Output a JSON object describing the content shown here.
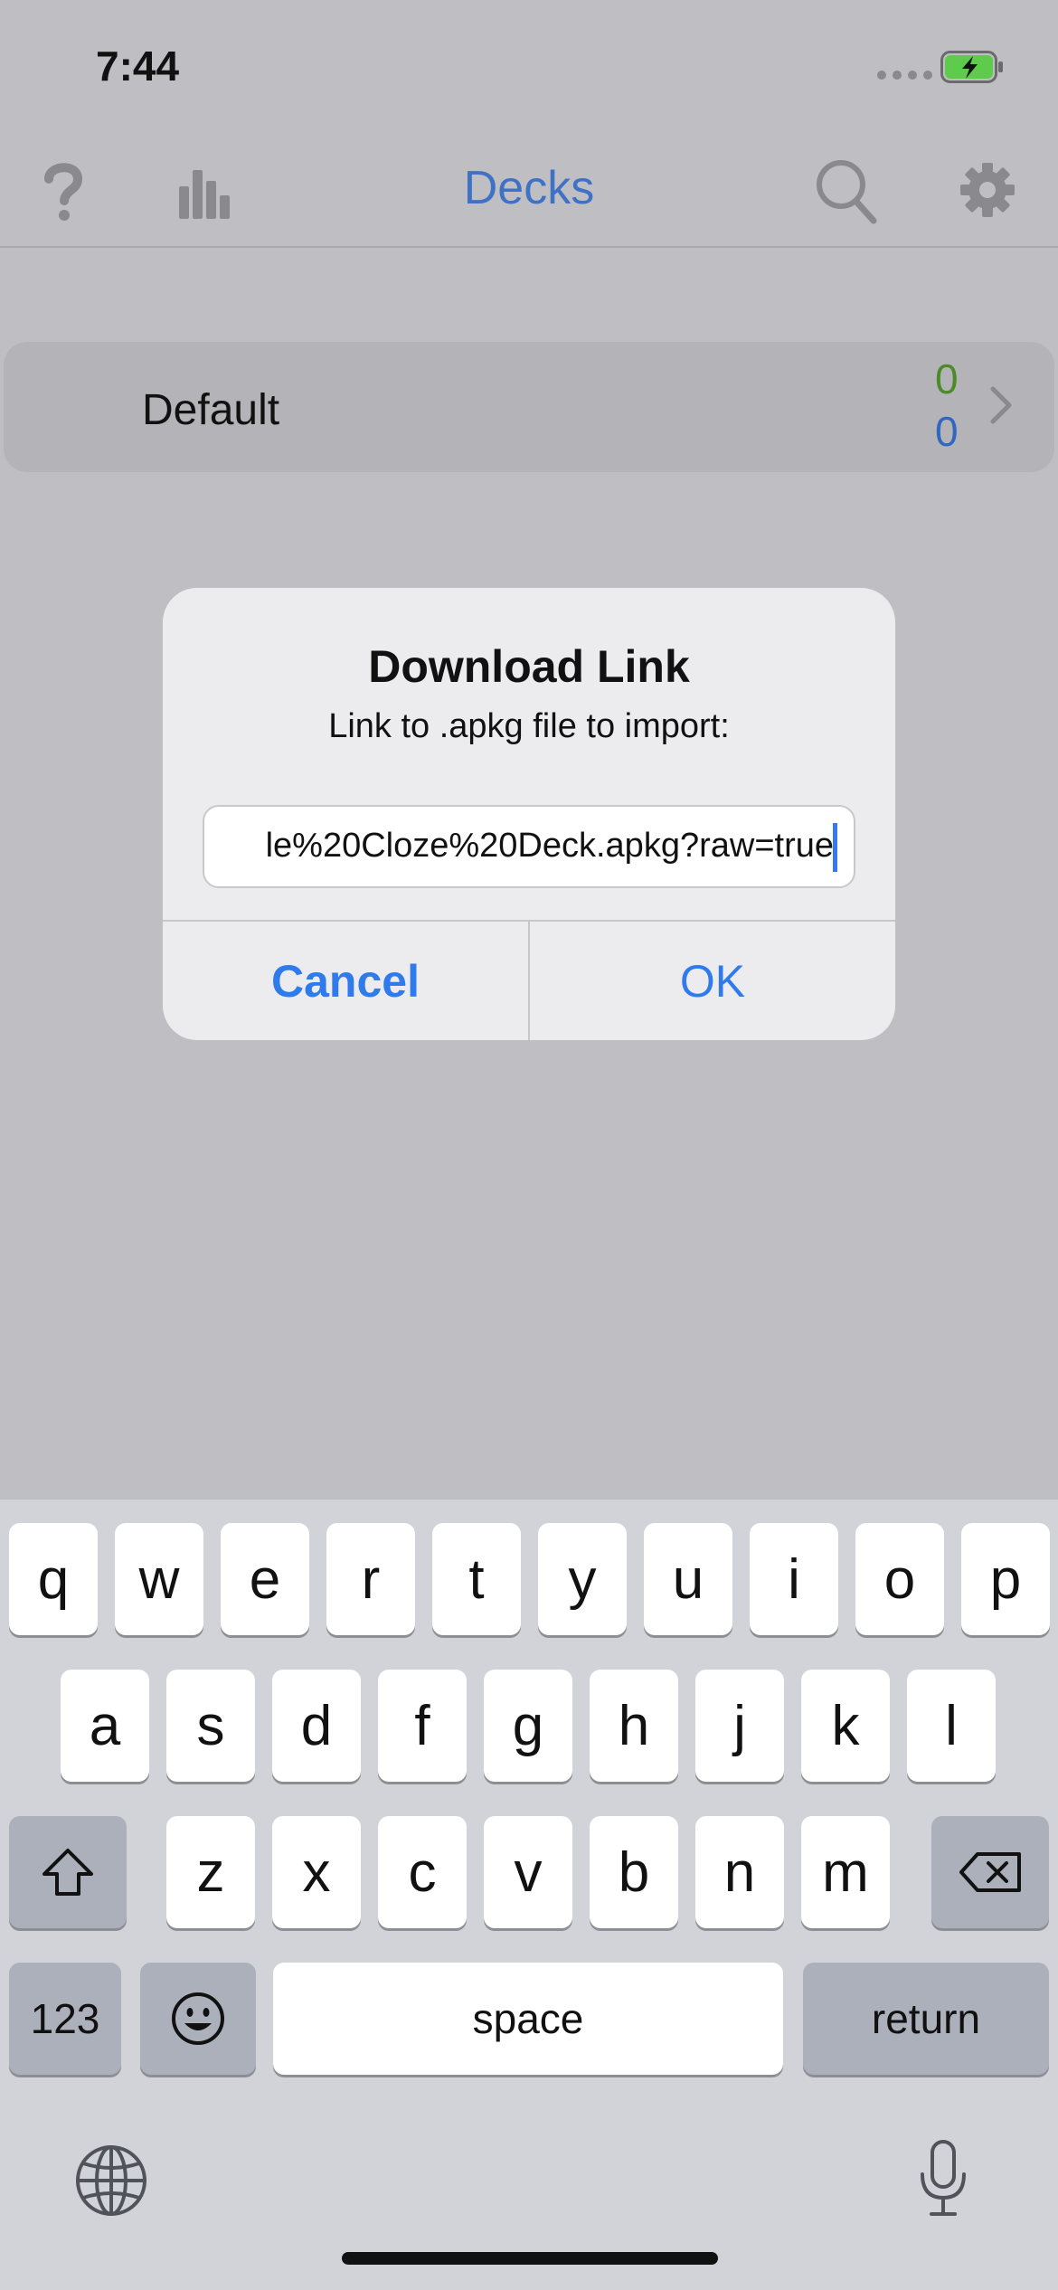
{
  "status": {
    "time": "7:44"
  },
  "nav": {
    "title": "Decks",
    "icons": [
      "help-icon",
      "stats-icon",
      "search-icon",
      "gear-icon"
    ]
  },
  "decks": [
    {
      "name": "Default",
      "new_count": "0",
      "due_count": "0"
    }
  ],
  "dialog": {
    "title": "Download Link",
    "message": "Link to .apkg file to import:",
    "input_value": "le%20Cloze%20Deck.apkg?raw=true",
    "cancel_label": "Cancel",
    "ok_label": "OK"
  },
  "keyboard": {
    "row1": [
      "q",
      "w",
      "e",
      "r",
      "t",
      "y",
      "u",
      "i",
      "o",
      "p"
    ],
    "row2": [
      "a",
      "s",
      "d",
      "f",
      "g",
      "h",
      "j",
      "k",
      "l"
    ],
    "row3": [
      "z",
      "x",
      "c",
      "v",
      "b",
      "n",
      "m"
    ],
    "numbers_label": "123",
    "space_label": "space",
    "return_label": "return"
  },
  "colors": {
    "accent": "#2f7bec",
    "nav_title": "#3f72c4",
    "new_count": "#4d8b2a",
    "due_count": "#3266c0",
    "battery": "#5fcb4c"
  }
}
